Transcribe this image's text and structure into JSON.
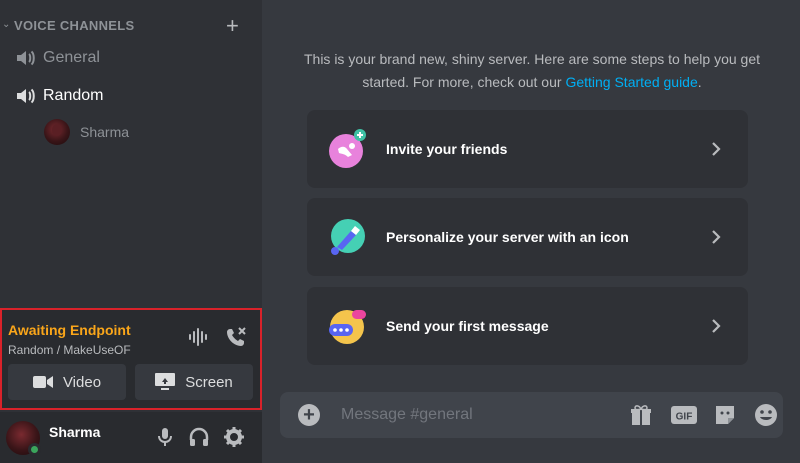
{
  "sidebar": {
    "section_title": "VOICE CHANNELS",
    "add_symbol": "+",
    "chevron": "⌄",
    "channels": [
      {
        "name": "General",
        "icon": "speaker-icon"
      },
      {
        "name": "Random",
        "icon": "speaker-icon"
      }
    ],
    "voice_user": {
      "name": "Sharma"
    }
  },
  "voice_panel": {
    "status": "Awaiting Endpoint",
    "location": "Random / MakeUseOF",
    "video_label": "Video",
    "screen_label": "Screen",
    "status_color": "#faa61a",
    "highlight_color": "#d9222a"
  },
  "user_panel": {
    "username": "Sharma",
    "status_color": "#3ba55c"
  },
  "main": {
    "welcome_text": "This is your brand new, shiny server. Here are some steps to help you get started. For more, check out our",
    "welcome_link": "Getting Started guide",
    "welcome_end": ".",
    "cards": [
      {
        "label": "Invite your friends",
        "icon": "invite-friends-icon"
      },
      {
        "label": "Personalize your server with an icon",
        "icon": "personalize-icon"
      },
      {
        "label": "Send your first message",
        "icon": "first-message-icon"
      }
    ],
    "composer": {
      "placeholder": "Message #general",
      "gif_label": "GIF"
    },
    "link_color": "#00aff4"
  }
}
